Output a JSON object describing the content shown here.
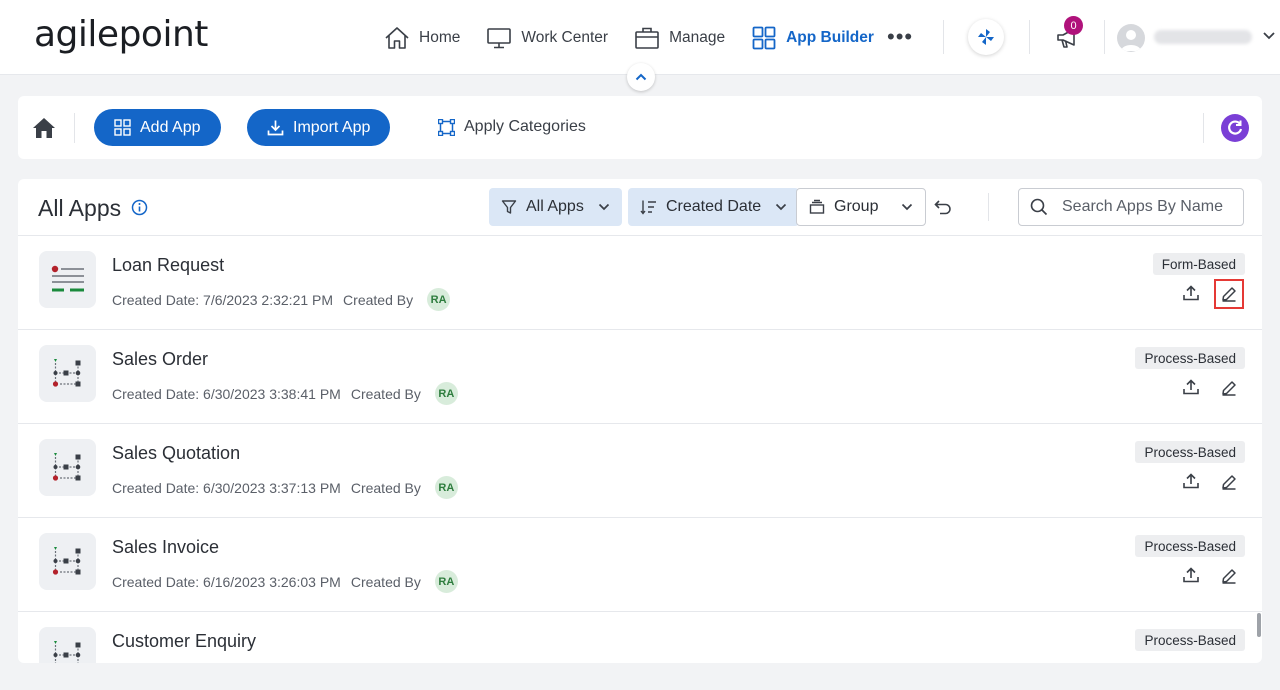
{
  "header": {
    "logo_text": "agilepoint",
    "nav": [
      {
        "label": "Home",
        "icon": "home-icon"
      },
      {
        "label": "Work Center",
        "icon": "monitor-icon"
      },
      {
        "label": "Manage",
        "icon": "briefcase-icon"
      },
      {
        "label": "App Builder",
        "icon": "grid-icon",
        "active": true
      }
    ],
    "more_icon": "more-dots-icon",
    "notifications_count": "0",
    "accent_color": "#1466c8"
  },
  "toolbar": {
    "add_app": "Add App",
    "import_app": "Import App",
    "apply_categories": "Apply Categories"
  },
  "main": {
    "title": "All Apps",
    "filters": {
      "all_apps": "All Apps",
      "created_date": "Created Date",
      "group": "Group"
    },
    "search_placeholder": "Search Apps By Name",
    "apps": [
      {
        "name": "Loan Request",
        "created": "Created Date: 7/6/2023 2:32:21 PM",
        "created_by": "Created By",
        "initials": "RA",
        "type": "Form-Based",
        "icon": "form-app-icon"
      },
      {
        "name": "Sales Order",
        "created": "Created Date: 6/30/2023 3:38:41 PM",
        "created_by": "Created By",
        "initials": "RA",
        "type": "Process-Based",
        "icon": "process-app-icon"
      },
      {
        "name": "Sales Quotation",
        "created": "Created Date: 6/30/2023 3:37:13 PM",
        "created_by": "Created By",
        "initials": "RA",
        "type": "Process-Based",
        "icon": "process-app-icon"
      },
      {
        "name": "Sales Invoice",
        "created": "Created Date: 6/16/2023 3:26:03 PM",
        "created_by": "Created By",
        "initials": "RA",
        "type": "Process-Based",
        "icon": "process-app-icon"
      },
      {
        "name": "Customer Enquiry",
        "created": "",
        "created_by": "",
        "initials": "",
        "type": "Process-Based",
        "icon": "process-app-icon"
      }
    ]
  }
}
